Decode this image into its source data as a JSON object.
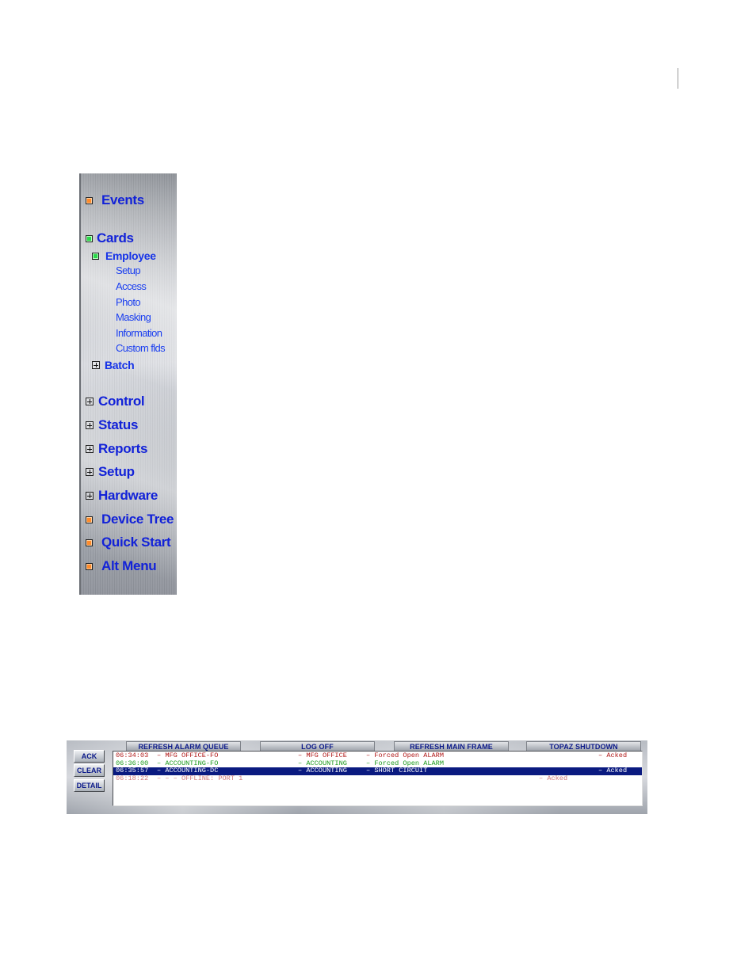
{
  "navigation": {
    "events": "Events",
    "cards": "Cards",
    "employee": "Employee",
    "employee_items": [
      "Setup",
      "Access",
      "Photo",
      "Masking",
      "Information",
      "Custom flds"
    ],
    "batch": "Batch",
    "control": "Control",
    "status": "Status",
    "reports": "Reports",
    "setup": "Setup",
    "hardware": "Hardware",
    "device_tree": "Device Tree",
    "quick_start": "Quick Start",
    "alt_menu": "Alt Menu"
  },
  "alarm_panel": {
    "tabs": [
      "REFRESH ALARM QUEUE",
      "LOG OFF",
      "REFRESH MAIN FRAME",
      "TOPAZ SHUTDOWN"
    ],
    "buttons": [
      "ACK",
      "CLEAR",
      "DETAIL"
    ],
    "rows": [
      {
        "time": "06:34:03",
        "point": "– MFG OFFICE-FO",
        "area": "– MFG OFFICE",
        "event": "– Forced Open ALARM",
        "status": "– Acked"
      },
      {
        "time": "06:36:00",
        "point": "– ACCOUNTING-FO",
        "area": "– ACCOUNTING",
        "event": "– Forced Open ALARM",
        "status": ""
      },
      {
        "time": "06:35:57",
        "point": "– ACCOUNTING-DC",
        "area": "– ACCOUNTING",
        "event": "– SHORT CIRCUIT",
        "status": "– Acked"
      },
      {
        "time": "06:18:22",
        "point": "–   –   – OFFLINE: PORT 1",
        "area": "",
        "event": "",
        "status": "– Acked"
      }
    ]
  },
  "colors": {
    "nav_text": "#1222d8",
    "row_red": "#b01818",
    "row_green": "#1c9a1c",
    "row_selected_bg": "#0a1a80",
    "row_selected_text": "#ffffff",
    "row_faded": "#d07a7a"
  }
}
